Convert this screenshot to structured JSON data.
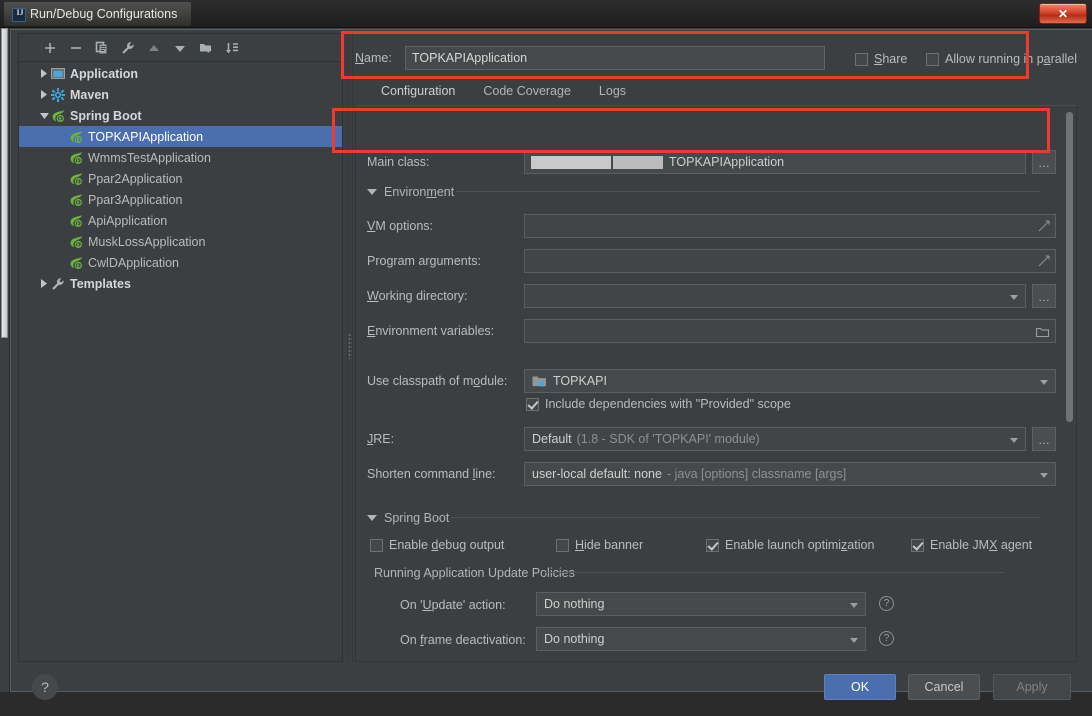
{
  "window": {
    "title": "Run/Debug Configurations",
    "app_icon": "intellij-icon",
    "close_label": "✕"
  },
  "toolbar": {
    "buttons": [
      {
        "name": "add-configuration",
        "icon": "plus-icon"
      },
      {
        "name": "remove-configuration",
        "icon": "minus-icon"
      },
      {
        "name": "copy-configuration",
        "icon": "copy-icon"
      },
      {
        "name": "edit-templates",
        "icon": "wrench-icon"
      },
      {
        "name": "move-up",
        "icon": "arrow-up-icon"
      },
      {
        "name": "move-down",
        "icon": "arrow-down-icon"
      },
      {
        "name": "create-folder",
        "icon": "folder-add-icon"
      },
      {
        "name": "sort-configurations",
        "icon": "sort-icon"
      }
    ]
  },
  "tree": {
    "items": [
      {
        "label": "Application",
        "icon": "application-icon",
        "type": "group",
        "expanded": false,
        "selected": false
      },
      {
        "label": "Maven",
        "icon": "maven-icon",
        "type": "group",
        "expanded": false,
        "selected": false
      },
      {
        "label": "Spring Boot",
        "icon": "spring-boot-icon",
        "type": "group",
        "expanded": true,
        "selected": false
      },
      {
        "label": "TOPKAPIApplication",
        "icon": "spring-boot-icon",
        "type": "child",
        "selected": true
      },
      {
        "label": "WmmsTestApplication",
        "icon": "spring-boot-icon",
        "type": "child",
        "selected": false
      },
      {
        "label": "Ppar2Application",
        "icon": "spring-boot-icon",
        "type": "child",
        "selected": false
      },
      {
        "label": "Ppar3Application",
        "icon": "spring-boot-icon",
        "type": "child",
        "selected": false
      },
      {
        "label": "ApiApplication",
        "icon": "spring-boot-icon",
        "type": "child",
        "selected": false
      },
      {
        "label": "MuskLossApplication",
        "icon": "spring-boot-icon",
        "type": "child",
        "selected": false
      },
      {
        "label": "CwlDApplication",
        "icon": "spring-boot-icon",
        "type": "child",
        "selected": false
      },
      {
        "label": "Templates",
        "icon": "wrench-icon",
        "type": "group",
        "expanded": false,
        "selected": false
      }
    ]
  },
  "header": {
    "name_label": "Name:",
    "name_value": "TOPKAPIApplication",
    "share_label": "Share",
    "share_checked": false,
    "parallel_label": "Allow running in parallel",
    "parallel_checked": false
  },
  "tabs": [
    {
      "label": "Configuration",
      "active": true
    },
    {
      "label": "Code Coverage",
      "active": false
    },
    {
      "label": "Logs",
      "active": false
    }
  ],
  "form": {
    "main_class_label": "Main class:",
    "main_class_value": "TOPKAPIApplication",
    "main_class_browse": "…",
    "environment_section": "Environment",
    "vm_options_label": "VM options:",
    "vm_options_value": "",
    "program_args_label": "Program arguments:",
    "program_args_value": "",
    "working_dir_label": "Working directory:",
    "working_dir_value": "",
    "working_dir_browse": "…",
    "env_vars_label": "Environment variables:",
    "env_vars_value": "",
    "classpath_label": "Use classpath of module:",
    "classpath_value": "TOPKAPI",
    "classpath_icon": "module-icon",
    "provided_scope_label": "Include dependencies with \"Provided\" scope",
    "provided_scope_checked": true,
    "jre_label": "JRE:",
    "jre_value": "Default",
    "jre_value_hint": "(1.8 - SDK of 'TOPKAPI' module)",
    "jre_browse": "…",
    "shorten_label": "Shorten command line:",
    "shorten_value": "user-local default: none",
    "shorten_value_hint": "- java [options] classname [args]"
  },
  "spring_boot": {
    "section_label": "Spring Boot",
    "checkboxes": [
      {
        "label": "Enable debug output",
        "checked": false
      },
      {
        "label": "Hide banner",
        "checked": false
      },
      {
        "label": "Enable launch optimization",
        "checked": true
      },
      {
        "label": "Enable JMX agent",
        "checked": true
      }
    ],
    "policies_label": "Running Application Update Policies",
    "update_action_label": "On 'Update' action:",
    "update_action_value": "Do nothing",
    "frame_deactivation_label": "On frame deactivation:",
    "frame_deactivation_value": "Do nothing",
    "help_glyph": "?"
  },
  "footer": {
    "help_label": "?",
    "ok_label": "OK",
    "cancel_label": "Cancel",
    "apply_label": "Apply"
  },
  "colors": {
    "accent": "#4b6eaf",
    "annotation": "#ef3b2d",
    "background": "#3c3f41",
    "field": "#45494a"
  }
}
